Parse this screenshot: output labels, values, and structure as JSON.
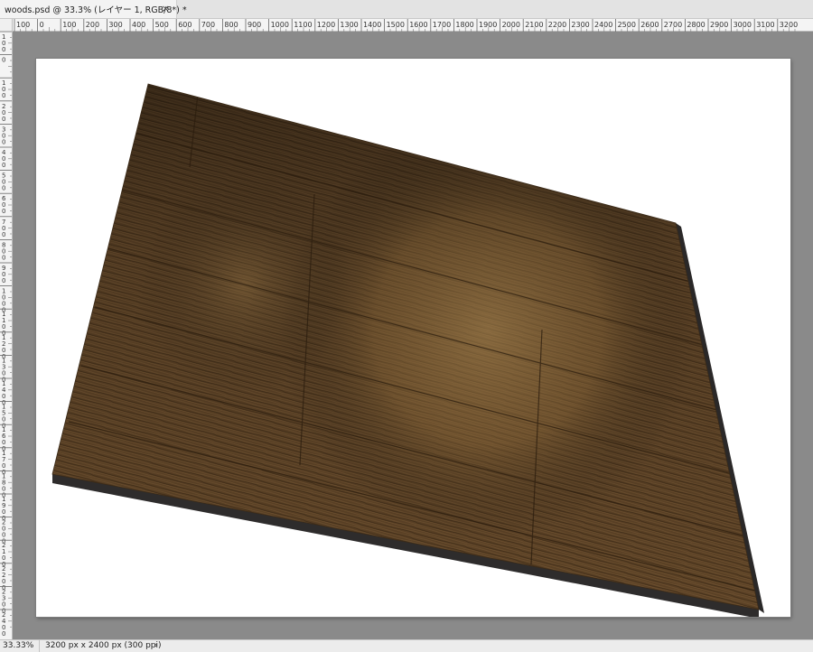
{
  "tab": {
    "title": "woods.psd @ 33.3% (レイヤー 1, RGB/8*) *",
    "close_glyph": "×",
    "close_icon": "close-icon"
  },
  "ruler": {
    "horizontal_labels": [
      "100",
      "0",
      "100",
      "200",
      "300",
      "400",
      "500",
      "600",
      "700",
      "800",
      "900",
      "1000",
      "1100",
      "1200",
      "1300",
      "1400",
      "1500",
      "1600",
      "1700",
      "1800",
      "1900",
      "2000",
      "2100",
      "2200",
      "2300",
      "2400",
      "2500",
      "2600",
      "2700",
      "2800",
      "2900",
      "3000",
      "3100",
      "3200"
    ],
    "vertical_labels": [
      "100",
      "0",
      "100",
      "200",
      "300",
      "400",
      "500",
      "600",
      "700",
      "800",
      "900",
      "1000",
      "1100",
      "1200",
      "1300",
      "1400",
      "1500",
      "1600",
      "1700",
      "1800",
      "1900",
      "2000",
      "2100",
      "2200",
      "2300",
      "2400"
    ]
  },
  "status": {
    "zoom": "33.33%",
    "doc_info": "3200 px x 2400 px (300 ppi)",
    "arrow_glyph": "›",
    "arrow_icon": "chevron-right-icon"
  },
  "colors": {
    "workspace": "#8a8a8a",
    "wood_base": "#5a3f22",
    "wood_light": "#b08a4e",
    "board_edge": "#2e2c2c"
  }
}
